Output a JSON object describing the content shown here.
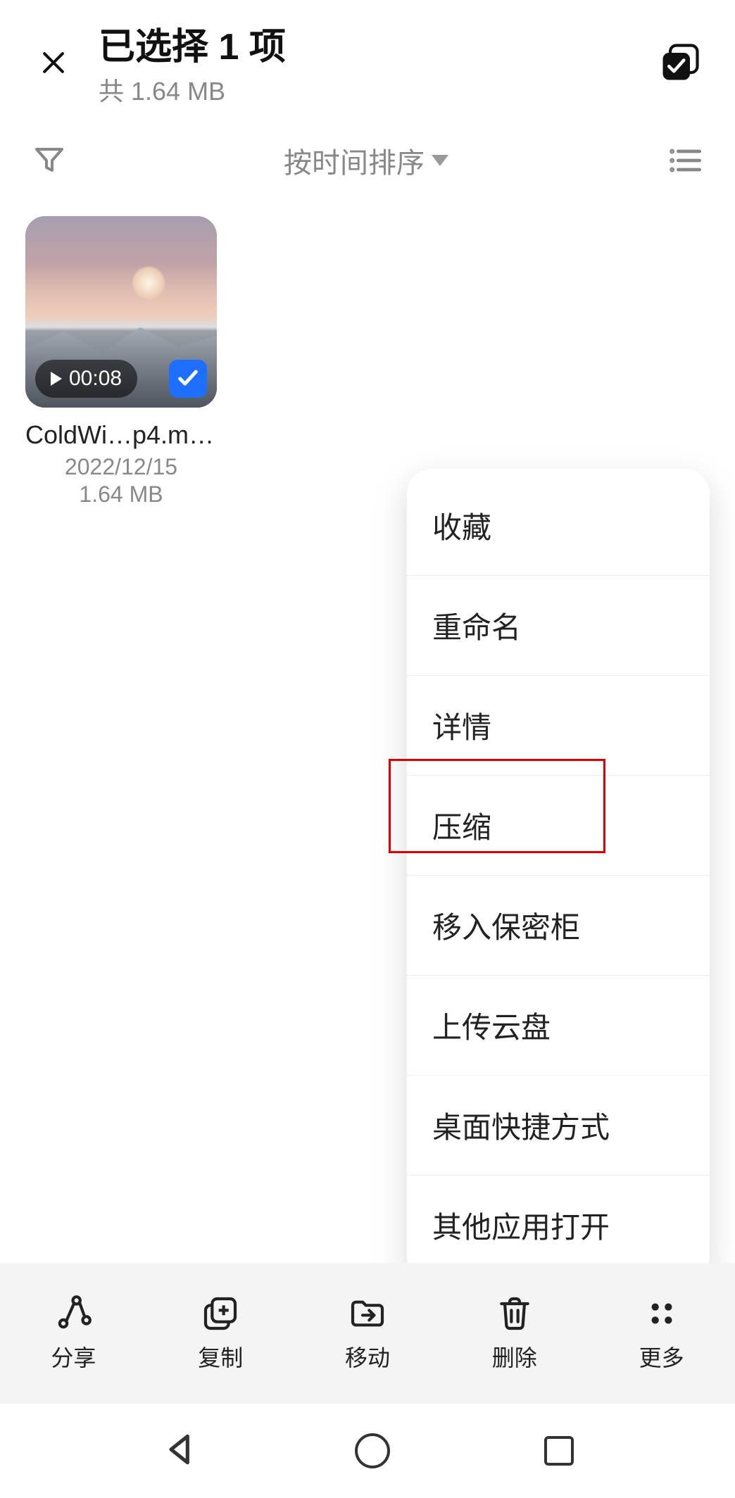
{
  "header": {
    "title": "已选择 1 项",
    "subtitle": "共 1.64 MB"
  },
  "sort": {
    "label": "按时间排序"
  },
  "file": {
    "duration": "00:08",
    "name": "ColdWi…p4.mp4",
    "date": "2022/12/15",
    "size": "1.64 MB"
  },
  "menu": {
    "items": [
      "收藏",
      "重命名",
      "详情",
      "压缩",
      "移入保密柜",
      "上传云盘",
      "桌面快捷方式",
      "其他应用打开"
    ]
  },
  "toolbar": {
    "share": "分享",
    "copy": "复制",
    "move": "移动",
    "delete": "删除",
    "more": "更多"
  }
}
